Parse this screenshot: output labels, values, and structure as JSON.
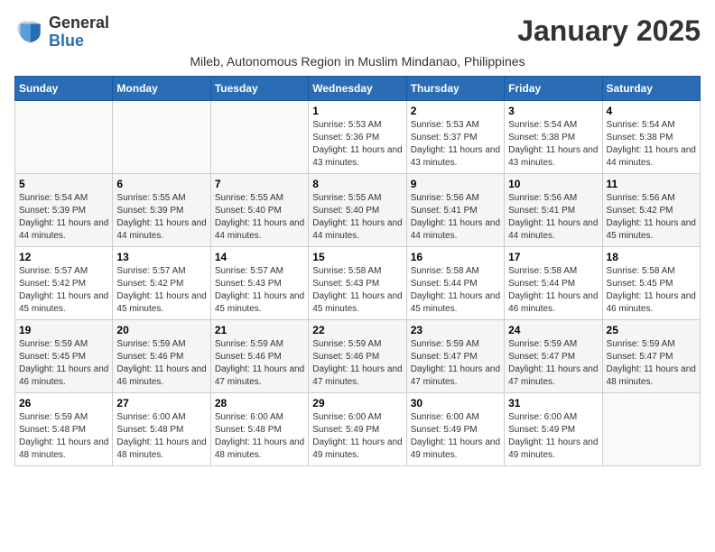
{
  "logo": {
    "general": "General",
    "blue": "Blue"
  },
  "title": "January 2025",
  "subtitle": "Mileb, Autonomous Region in Muslim Mindanao, Philippines",
  "weekdays": [
    "Sunday",
    "Monday",
    "Tuesday",
    "Wednesday",
    "Thursday",
    "Friday",
    "Saturday"
  ],
  "weeks": [
    [
      {
        "day": "",
        "sunrise": "",
        "sunset": "",
        "daylight": ""
      },
      {
        "day": "",
        "sunrise": "",
        "sunset": "",
        "daylight": ""
      },
      {
        "day": "",
        "sunrise": "",
        "sunset": "",
        "daylight": ""
      },
      {
        "day": "1",
        "sunrise": "Sunrise: 5:53 AM",
        "sunset": "Sunset: 5:36 PM",
        "daylight": "Daylight: 11 hours and 43 minutes."
      },
      {
        "day": "2",
        "sunrise": "Sunrise: 5:53 AM",
        "sunset": "Sunset: 5:37 PM",
        "daylight": "Daylight: 11 hours and 43 minutes."
      },
      {
        "day": "3",
        "sunrise": "Sunrise: 5:54 AM",
        "sunset": "Sunset: 5:38 PM",
        "daylight": "Daylight: 11 hours and 43 minutes."
      },
      {
        "day": "4",
        "sunrise": "Sunrise: 5:54 AM",
        "sunset": "Sunset: 5:38 PM",
        "daylight": "Daylight: 11 hours and 44 minutes."
      }
    ],
    [
      {
        "day": "5",
        "sunrise": "Sunrise: 5:54 AM",
        "sunset": "Sunset: 5:39 PM",
        "daylight": "Daylight: 11 hours and 44 minutes."
      },
      {
        "day": "6",
        "sunrise": "Sunrise: 5:55 AM",
        "sunset": "Sunset: 5:39 PM",
        "daylight": "Daylight: 11 hours and 44 minutes."
      },
      {
        "day": "7",
        "sunrise": "Sunrise: 5:55 AM",
        "sunset": "Sunset: 5:40 PM",
        "daylight": "Daylight: 11 hours and 44 minutes."
      },
      {
        "day": "8",
        "sunrise": "Sunrise: 5:55 AM",
        "sunset": "Sunset: 5:40 PM",
        "daylight": "Daylight: 11 hours and 44 minutes."
      },
      {
        "day": "9",
        "sunrise": "Sunrise: 5:56 AM",
        "sunset": "Sunset: 5:41 PM",
        "daylight": "Daylight: 11 hours and 44 minutes."
      },
      {
        "day": "10",
        "sunrise": "Sunrise: 5:56 AM",
        "sunset": "Sunset: 5:41 PM",
        "daylight": "Daylight: 11 hours and 44 minutes."
      },
      {
        "day": "11",
        "sunrise": "Sunrise: 5:56 AM",
        "sunset": "Sunset: 5:42 PM",
        "daylight": "Daylight: 11 hours and 45 minutes."
      }
    ],
    [
      {
        "day": "12",
        "sunrise": "Sunrise: 5:57 AM",
        "sunset": "Sunset: 5:42 PM",
        "daylight": "Daylight: 11 hours and 45 minutes."
      },
      {
        "day": "13",
        "sunrise": "Sunrise: 5:57 AM",
        "sunset": "Sunset: 5:42 PM",
        "daylight": "Daylight: 11 hours and 45 minutes."
      },
      {
        "day": "14",
        "sunrise": "Sunrise: 5:57 AM",
        "sunset": "Sunset: 5:43 PM",
        "daylight": "Daylight: 11 hours and 45 minutes."
      },
      {
        "day": "15",
        "sunrise": "Sunrise: 5:58 AM",
        "sunset": "Sunset: 5:43 PM",
        "daylight": "Daylight: 11 hours and 45 minutes."
      },
      {
        "day": "16",
        "sunrise": "Sunrise: 5:58 AM",
        "sunset": "Sunset: 5:44 PM",
        "daylight": "Daylight: 11 hours and 45 minutes."
      },
      {
        "day": "17",
        "sunrise": "Sunrise: 5:58 AM",
        "sunset": "Sunset: 5:44 PM",
        "daylight": "Daylight: 11 hours and 46 minutes."
      },
      {
        "day": "18",
        "sunrise": "Sunrise: 5:58 AM",
        "sunset": "Sunset: 5:45 PM",
        "daylight": "Daylight: 11 hours and 46 minutes."
      }
    ],
    [
      {
        "day": "19",
        "sunrise": "Sunrise: 5:59 AM",
        "sunset": "Sunset: 5:45 PM",
        "daylight": "Daylight: 11 hours and 46 minutes."
      },
      {
        "day": "20",
        "sunrise": "Sunrise: 5:59 AM",
        "sunset": "Sunset: 5:46 PM",
        "daylight": "Daylight: 11 hours and 46 minutes."
      },
      {
        "day": "21",
        "sunrise": "Sunrise: 5:59 AM",
        "sunset": "Sunset: 5:46 PM",
        "daylight": "Daylight: 11 hours and 47 minutes."
      },
      {
        "day": "22",
        "sunrise": "Sunrise: 5:59 AM",
        "sunset": "Sunset: 5:46 PM",
        "daylight": "Daylight: 11 hours and 47 minutes."
      },
      {
        "day": "23",
        "sunrise": "Sunrise: 5:59 AM",
        "sunset": "Sunset: 5:47 PM",
        "daylight": "Daylight: 11 hours and 47 minutes."
      },
      {
        "day": "24",
        "sunrise": "Sunrise: 5:59 AM",
        "sunset": "Sunset: 5:47 PM",
        "daylight": "Daylight: 11 hours and 47 minutes."
      },
      {
        "day": "25",
        "sunrise": "Sunrise: 5:59 AM",
        "sunset": "Sunset: 5:47 PM",
        "daylight": "Daylight: 11 hours and 48 minutes."
      }
    ],
    [
      {
        "day": "26",
        "sunrise": "Sunrise: 5:59 AM",
        "sunset": "Sunset: 5:48 PM",
        "daylight": "Daylight: 11 hours and 48 minutes."
      },
      {
        "day": "27",
        "sunrise": "Sunrise: 6:00 AM",
        "sunset": "Sunset: 5:48 PM",
        "daylight": "Daylight: 11 hours and 48 minutes."
      },
      {
        "day": "28",
        "sunrise": "Sunrise: 6:00 AM",
        "sunset": "Sunset: 5:48 PM",
        "daylight": "Daylight: 11 hours and 48 minutes."
      },
      {
        "day": "29",
        "sunrise": "Sunrise: 6:00 AM",
        "sunset": "Sunset: 5:49 PM",
        "daylight": "Daylight: 11 hours and 49 minutes."
      },
      {
        "day": "30",
        "sunrise": "Sunrise: 6:00 AM",
        "sunset": "Sunset: 5:49 PM",
        "daylight": "Daylight: 11 hours and 49 minutes."
      },
      {
        "day": "31",
        "sunrise": "Sunrise: 6:00 AM",
        "sunset": "Sunset: 5:49 PM",
        "daylight": "Daylight: 11 hours and 49 minutes."
      },
      {
        "day": "",
        "sunrise": "",
        "sunset": "",
        "daylight": ""
      }
    ]
  ]
}
